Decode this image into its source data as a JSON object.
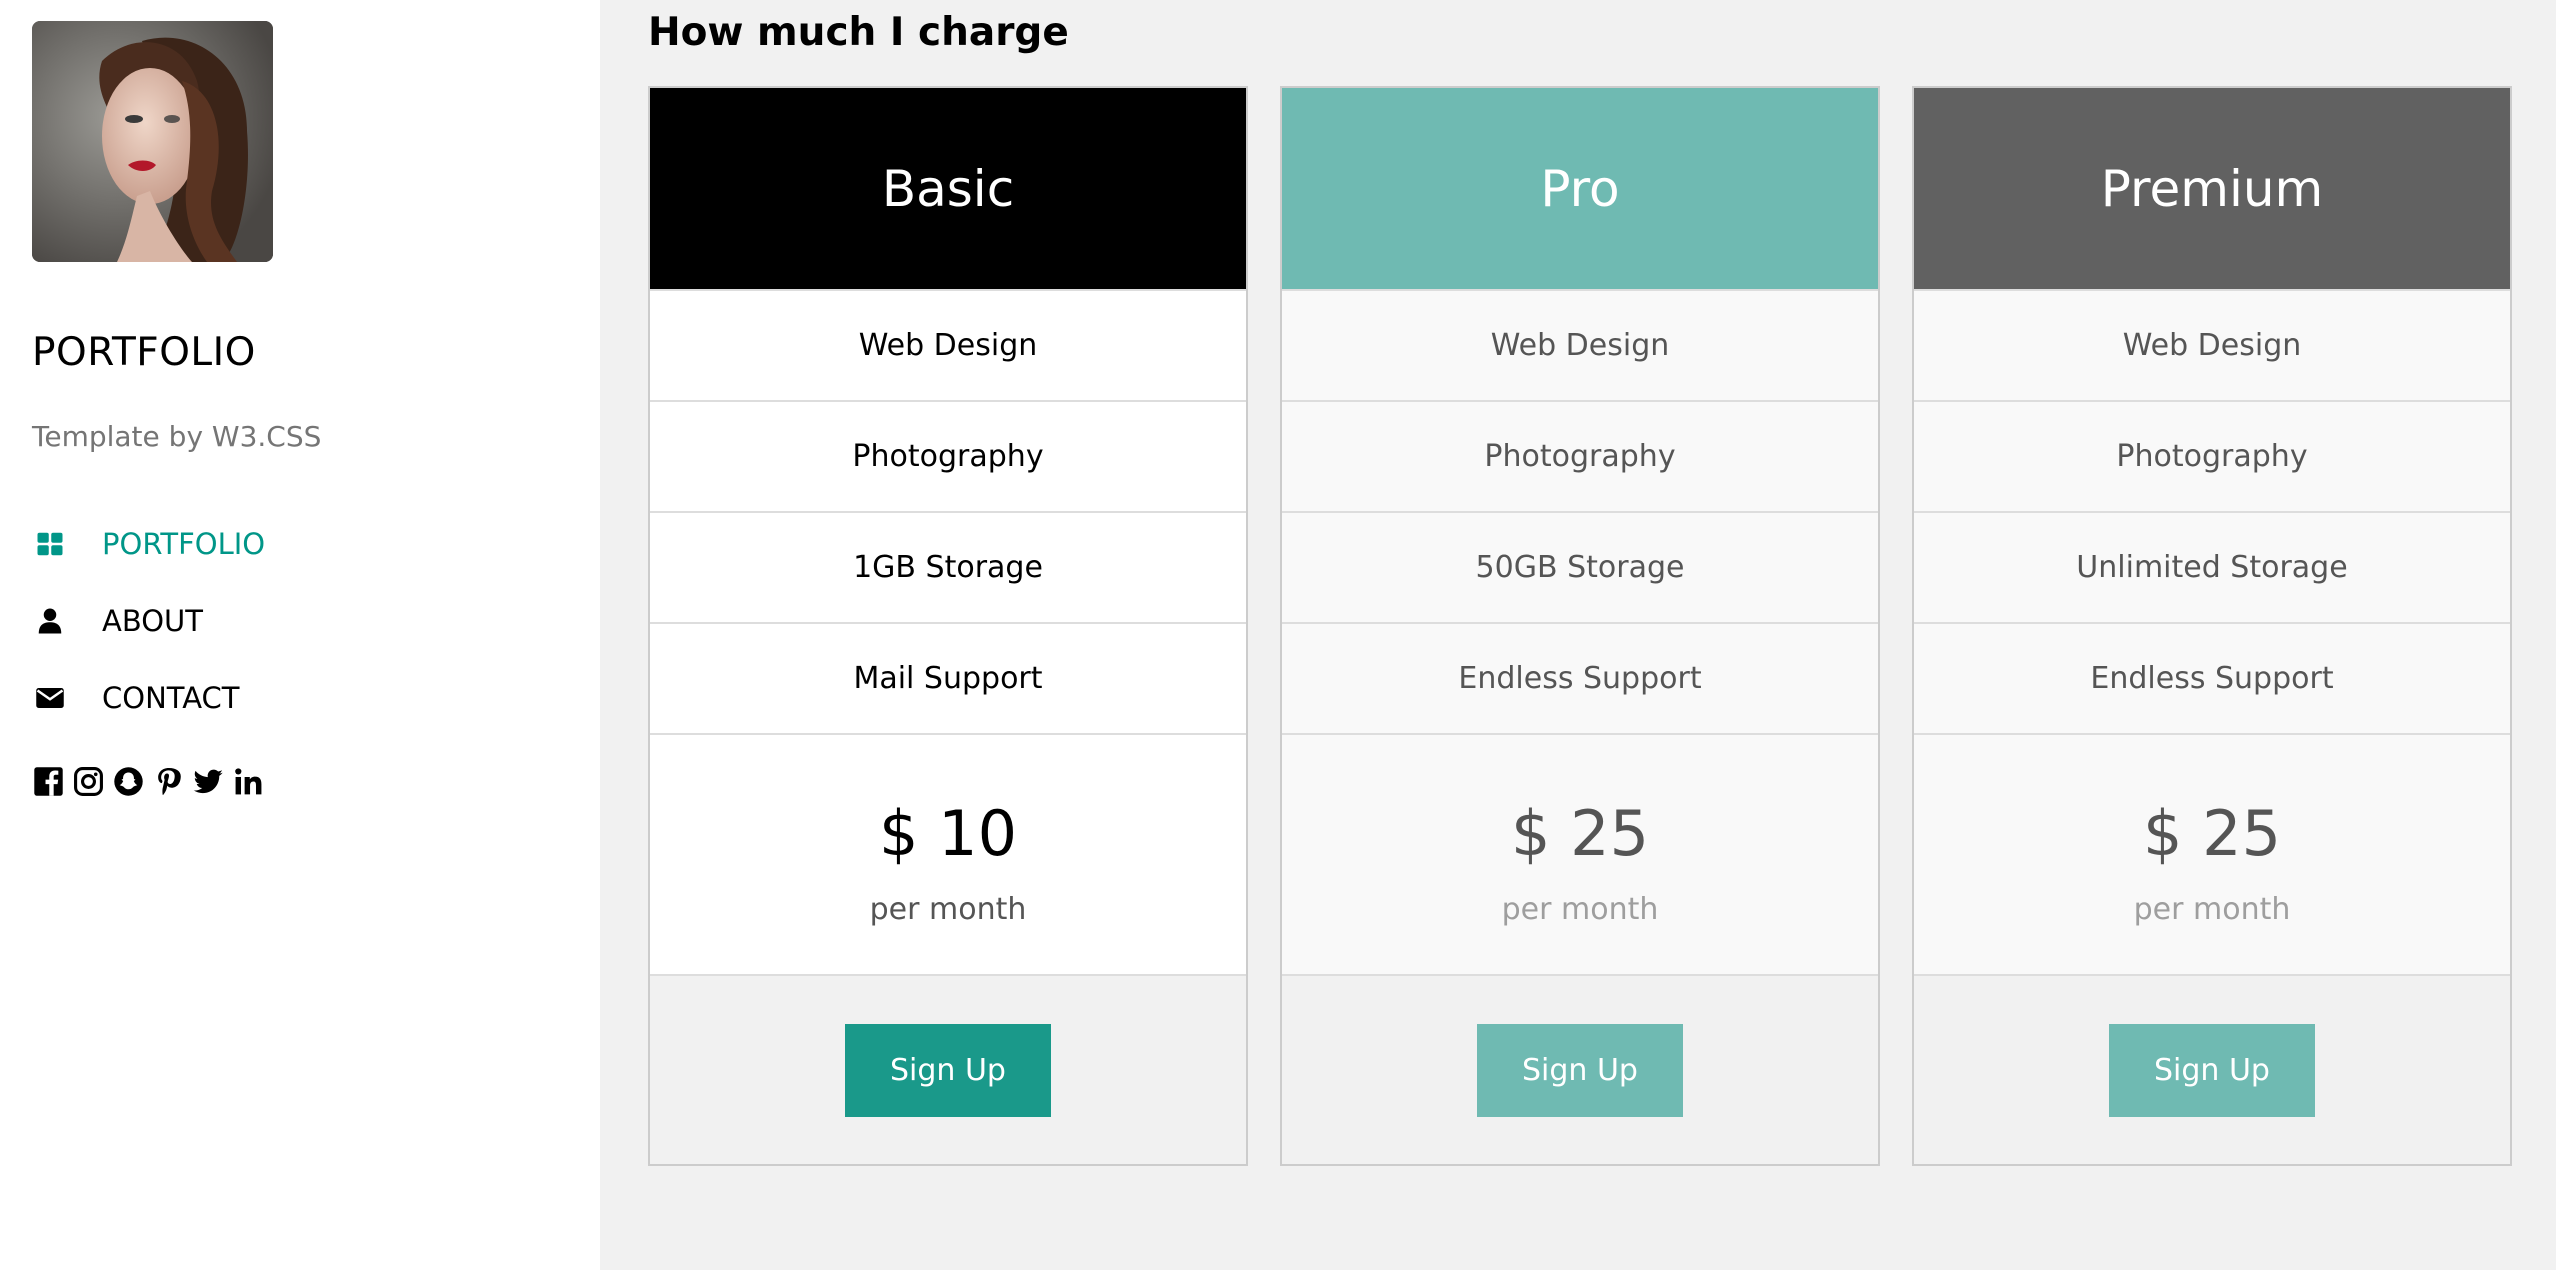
{
  "sidebar": {
    "brand": "PORTFOLIO",
    "tagline": "Template by W3.CSS",
    "nav": [
      {
        "label": "PORTFOLIO",
        "icon": "grid-icon",
        "active": true
      },
      {
        "label": "ABOUT",
        "icon": "user-icon",
        "active": false
      },
      {
        "label": "CONTACT",
        "icon": "envelope-icon",
        "active": false
      }
    ],
    "social_icons": [
      "facebook-icon",
      "instagram-icon",
      "snapchat-icon",
      "pinterest-icon",
      "twitter-icon",
      "linkedin-icon"
    ]
  },
  "main": {
    "title": "How much I charge",
    "plans": [
      {
        "name": "Basic",
        "header_color": "#000000",
        "features": [
          "Web Design",
          "Photography",
          "1GB Storage",
          "Mail Support"
        ],
        "price": "$ 10",
        "period": "per month",
        "button": "Sign Up",
        "button_color": "#1a998a"
      },
      {
        "name": "Pro",
        "header_color": "#6fbab2",
        "features": [
          "Web Design",
          "Photography",
          "50GB Storage",
          "Endless Support"
        ],
        "price": "$ 25",
        "period": "per month",
        "button": "Sign Up",
        "button_color": "#6fbab2"
      },
      {
        "name": "Premium",
        "header_color": "#616161",
        "features": [
          "Web Design",
          "Photography",
          "Unlimited Storage",
          "Endless Support"
        ],
        "price": "$ 25",
        "period": "per month",
        "button": "Sign Up",
        "button_color": "#6fbab2"
      }
    ]
  },
  "colors": {
    "accent": "#009688",
    "page_bg": "#f1f1f1",
    "sidebar_bg": "#ffffff"
  }
}
